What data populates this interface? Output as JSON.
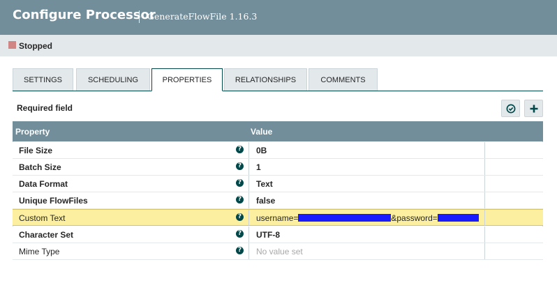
{
  "header": {
    "title": "Configure Processor",
    "subtitle": "GenerateFlowFile 1.16.3"
  },
  "status": {
    "text": "Stopped",
    "color": "#d18686"
  },
  "tabs": [
    {
      "label": "SETTINGS",
      "active": false
    },
    {
      "label": "SCHEDULING",
      "active": false
    },
    {
      "label": "PROPERTIES",
      "active": true
    },
    {
      "label": "RELATIONSHIPS",
      "active": false
    },
    {
      "label": "COMMENTS",
      "active": false
    }
  ],
  "properties_panel": {
    "required_label": "Required field",
    "verify_icon": "check-circle-icon",
    "add_icon": "plus-icon",
    "columns": {
      "property": "Property",
      "value": "Value"
    },
    "rows": [
      {
        "name": "File Size",
        "value": "0B",
        "required": true
      },
      {
        "name": "Batch Size",
        "value": "1",
        "required": true
      },
      {
        "name": "Data Format",
        "value": "Text",
        "required": true
      },
      {
        "name": "Unique FlowFiles",
        "value": "false",
        "required": true
      },
      {
        "name": "Custom Text",
        "value_prefix": "username=",
        "value_middle": "&password=",
        "redacted": true,
        "highlighted": true
      },
      {
        "name": "Character Set",
        "value": "UTF-8",
        "required": true
      },
      {
        "name": "Mime Type",
        "value": "No value set",
        "required": false,
        "empty": true
      }
    ]
  },
  "colors": {
    "header": "#728e9b",
    "accent": "#004849",
    "highlight": "#fcef9f",
    "redaction": "#1a1aff"
  }
}
